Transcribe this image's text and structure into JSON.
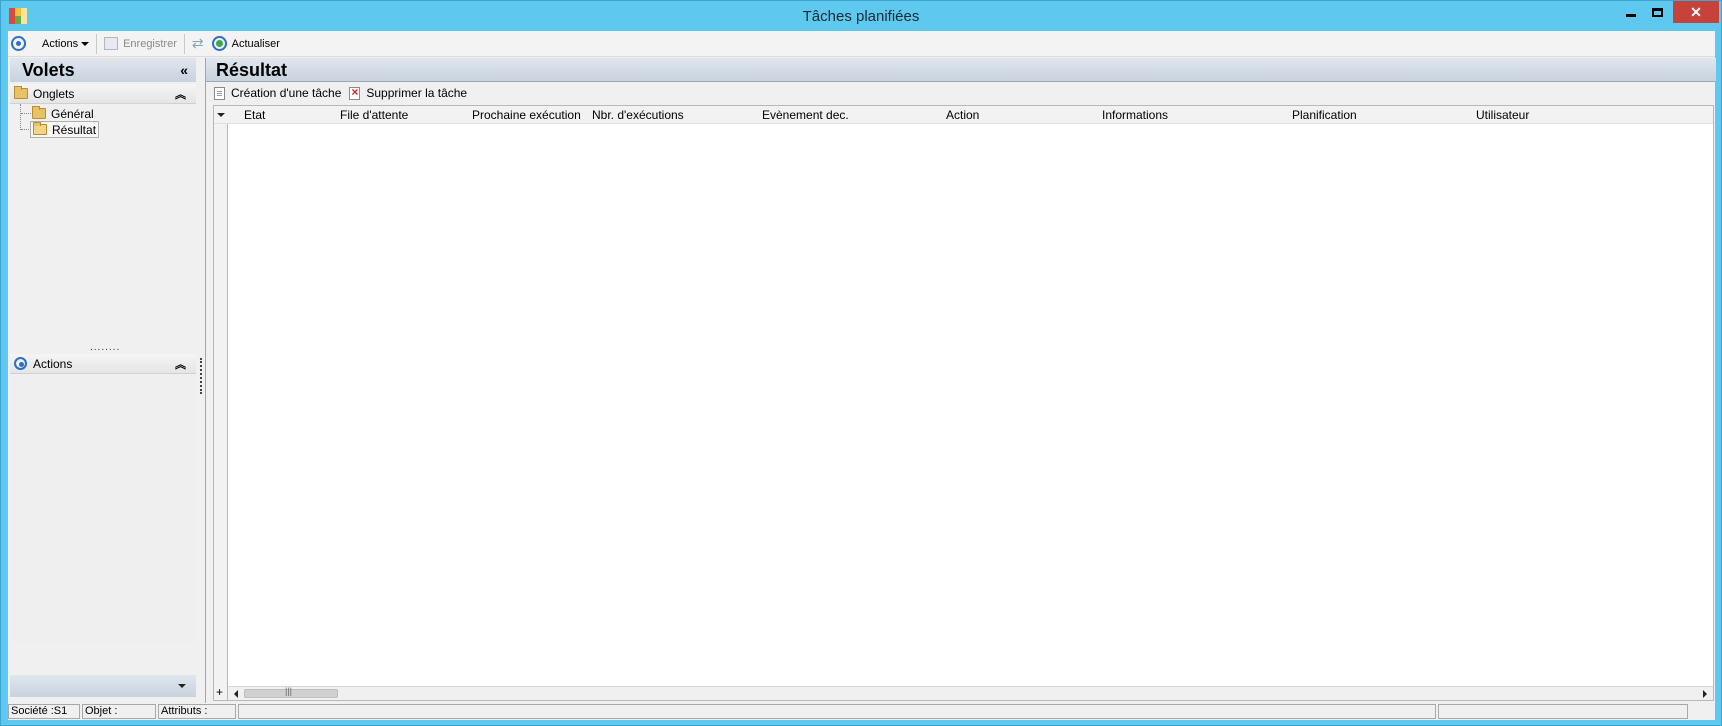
{
  "window": {
    "title": "Tâches planifiées",
    "minimize": "minimize",
    "maximize": "maximize",
    "close": "close"
  },
  "toolbar": {
    "actions_label": "Actions",
    "save_label": "Enregistrer",
    "refresh_label": "Actualiser"
  },
  "left_panel": {
    "title": "Volets",
    "collapse_glyph": "«",
    "tabs_section": "Onglets",
    "tree": [
      {
        "label": "Général",
        "selected": false
      },
      {
        "label": "Résultat",
        "selected": true
      }
    ],
    "splitter_dots": "........",
    "actions_section": "Actions",
    "chevron_up": "⌃"
  },
  "main": {
    "title": "Résultat",
    "create_task_label": "Création d'une tâche",
    "delete_task_label": "Supprimer la tâche",
    "columns": [
      "Etat",
      "File d'attente",
      "Prochaine exécution",
      "Nbr. d'exécutions",
      "Evènement dec.",
      "Action",
      "Informations",
      "Planification",
      "Utilisateur"
    ],
    "rows": []
  },
  "statusbar": {
    "company": "Société :S1",
    "object": "Objet :",
    "attributes": "Attributs :"
  },
  "colors": {
    "title_bar": "#5ec8ee",
    "close_button": "#c7423a",
    "panel_header": "#c9d3de"
  }
}
